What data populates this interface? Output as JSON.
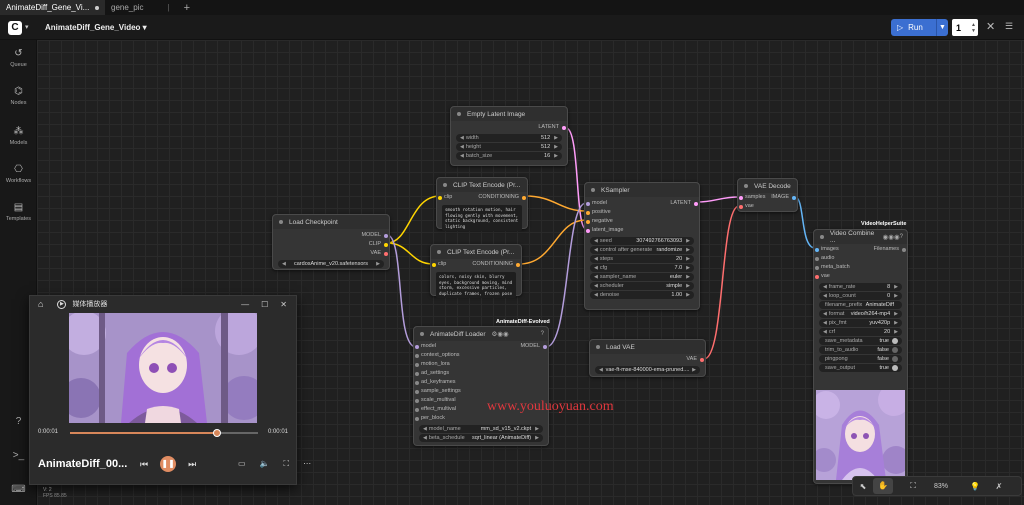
{
  "tabs": [
    {
      "label": "AnimateDiff_Gene_Vi..."
    },
    {
      "label": "gene_pic"
    }
  ],
  "toolbar": {
    "workflow_title": "AnimateDiff_Gene_Video",
    "run_label": "Run",
    "run_count": "1"
  },
  "sidebar": {
    "items": [
      {
        "label": "Queue"
      },
      {
        "label": "Nodes"
      },
      {
        "label": "Models"
      },
      {
        "label": "Workflows"
      },
      {
        "label": "Templates"
      }
    ]
  },
  "nodes": {
    "empty_latent": {
      "title": "Empty Latent Image",
      "output": "LATENT",
      "width_label": "width",
      "width_value": "512",
      "height_label": "height",
      "height_value": "512",
      "batch_label": "batch_size",
      "batch_value": "16"
    },
    "clip_pos": {
      "title": "CLIP Text Encode (Pr...",
      "input": "clip",
      "output": "CONDITIONING",
      "text": "smooth rotation motion, hair flowing gently with movement, static background, consistent lighting"
    },
    "clip_neg": {
      "title": "CLIP Text Encode (Pr...",
      "input": "clip",
      "output": "CONDITIONING",
      "text": "colors, noisy skin, blurry eyes, background moving, mind storm, excessive particles, duplicate frames, frozen pose"
    },
    "load_ckpt": {
      "title": "Load Checkpoint",
      "out_model": "MODEL",
      "out_clip": "CLIP",
      "out_vae": "VAE",
      "ckpt_value": "cardosAnime_v20.safetensors"
    },
    "ksampler": {
      "title": "KSampler",
      "in_model": "model",
      "in_positive": "positive",
      "in_negative": "negative",
      "in_latent": "latent_image",
      "output": "LATENT",
      "seed_label": "seed",
      "seed_value": "307492766763093",
      "control_label": "control after generate",
      "control_value": "randomize",
      "steps_label": "steps",
      "steps_value": "20",
      "cfg_label": "cfg",
      "cfg_value": "7.0",
      "sampler_label": "sampler_name",
      "sampler_value": "euler",
      "scheduler_label": "scheduler",
      "scheduler_value": "simple",
      "denoise_label": "denoise",
      "denoise_value": "1.00"
    },
    "vae_decode": {
      "title": "VAE Decode",
      "in_samples": "samples",
      "in_vae": "vae",
      "output": "IMAGE"
    },
    "load_vae": {
      "title": "Load VAE",
      "output": "VAE",
      "vae_value": "vae-ft-mse-840000-ema-pruned...."
    },
    "animatediff": {
      "title": "AnimateDiff Loader",
      "badge": "AnimateDiff-Evolved",
      "inputs": [
        "model",
        "context_options",
        "motion_lora",
        "ad_settings",
        "ad_keyframes",
        "sample_settings",
        "scale_multival",
        "effect_multival",
        "per_block"
      ],
      "output": "MODEL",
      "model_name_label": "model_name",
      "model_name_value": "mm_sd_v15_v2.ckpt",
      "beta_label": "beta_schedule",
      "beta_value": "sqrt_linear (AnimateDiff)"
    },
    "video_combine": {
      "title": "Video Combine ...",
      "badge": "VideoHelperSuite",
      "inputs": [
        "images",
        "audio",
        "meta_batch",
        "vae"
      ],
      "output": "Filenames",
      "frame_rate_label": "frame_rate",
      "frame_rate_value": "8",
      "loop_label": "loop_count",
      "loop_value": "0",
      "prefix_label": "filename_prefix",
      "prefix_value": "AnimateDiff",
      "format_label": "format",
      "format_value": "video/h264-mp4",
      "pixfmt_label": "pix_fmt",
      "pixfmt_value": "yuv420p",
      "crf_label": "crf",
      "crf_value": "20",
      "save_meta_label": "save_metadata",
      "save_meta_value": "true",
      "trim_label": "trim_to_audio",
      "trim_value": "false",
      "pingpong_label": "pingpong",
      "pingpong_value": "false",
      "saveout_label": "save_output",
      "saveout_value": "true"
    }
  },
  "player": {
    "app_title": "媒体播放器",
    "time_current": "0:00:01",
    "time_total": "0:00:01",
    "progress": 0.78,
    "file_name": "AnimateDiff_00..."
  },
  "canvas_tools": {
    "zoom": "83%"
  },
  "watermark": "www.youluoyuan.com",
  "version": "V: 2\nFPS 85.85",
  "colors": {
    "accent": "#3b6fd1",
    "wire_latent": "#ff9cf9",
    "wire_model": "#b39ddb",
    "wire_clip": "#ffd500",
    "wire_vae": "#ff6e6e",
    "wire_image": "#64b5f6",
    "wire_cond": "#ffa931"
  }
}
